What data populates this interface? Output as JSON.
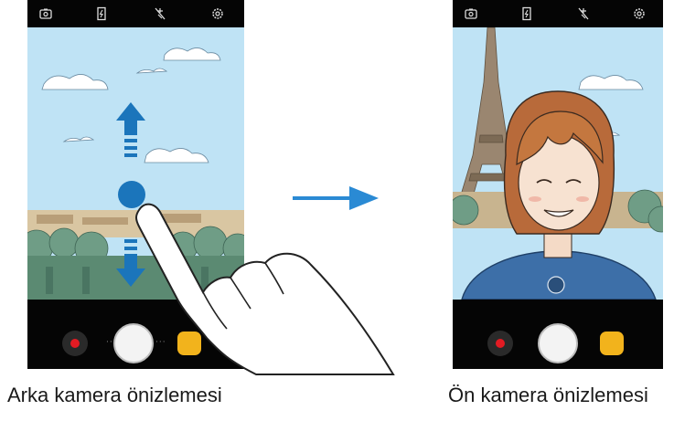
{
  "captions": {
    "rear": "Arka kamera önizlemesi",
    "front": "Ön kamera önizlemesi"
  },
  "toolbar_icons": [
    "switch-camera-icon",
    "flash-icon",
    "effects-off-icon",
    "settings-icon"
  ],
  "bottom_controls": [
    "record-button",
    "shutter-button",
    "filter-effects-button"
  ],
  "colors": {
    "sky": "#bfe3f5",
    "gesture_blue": "#1b75bb",
    "transition_arrow": "#2a8ad4",
    "record_red": "#e31b23",
    "effects_yellow": "#f2b31c"
  }
}
